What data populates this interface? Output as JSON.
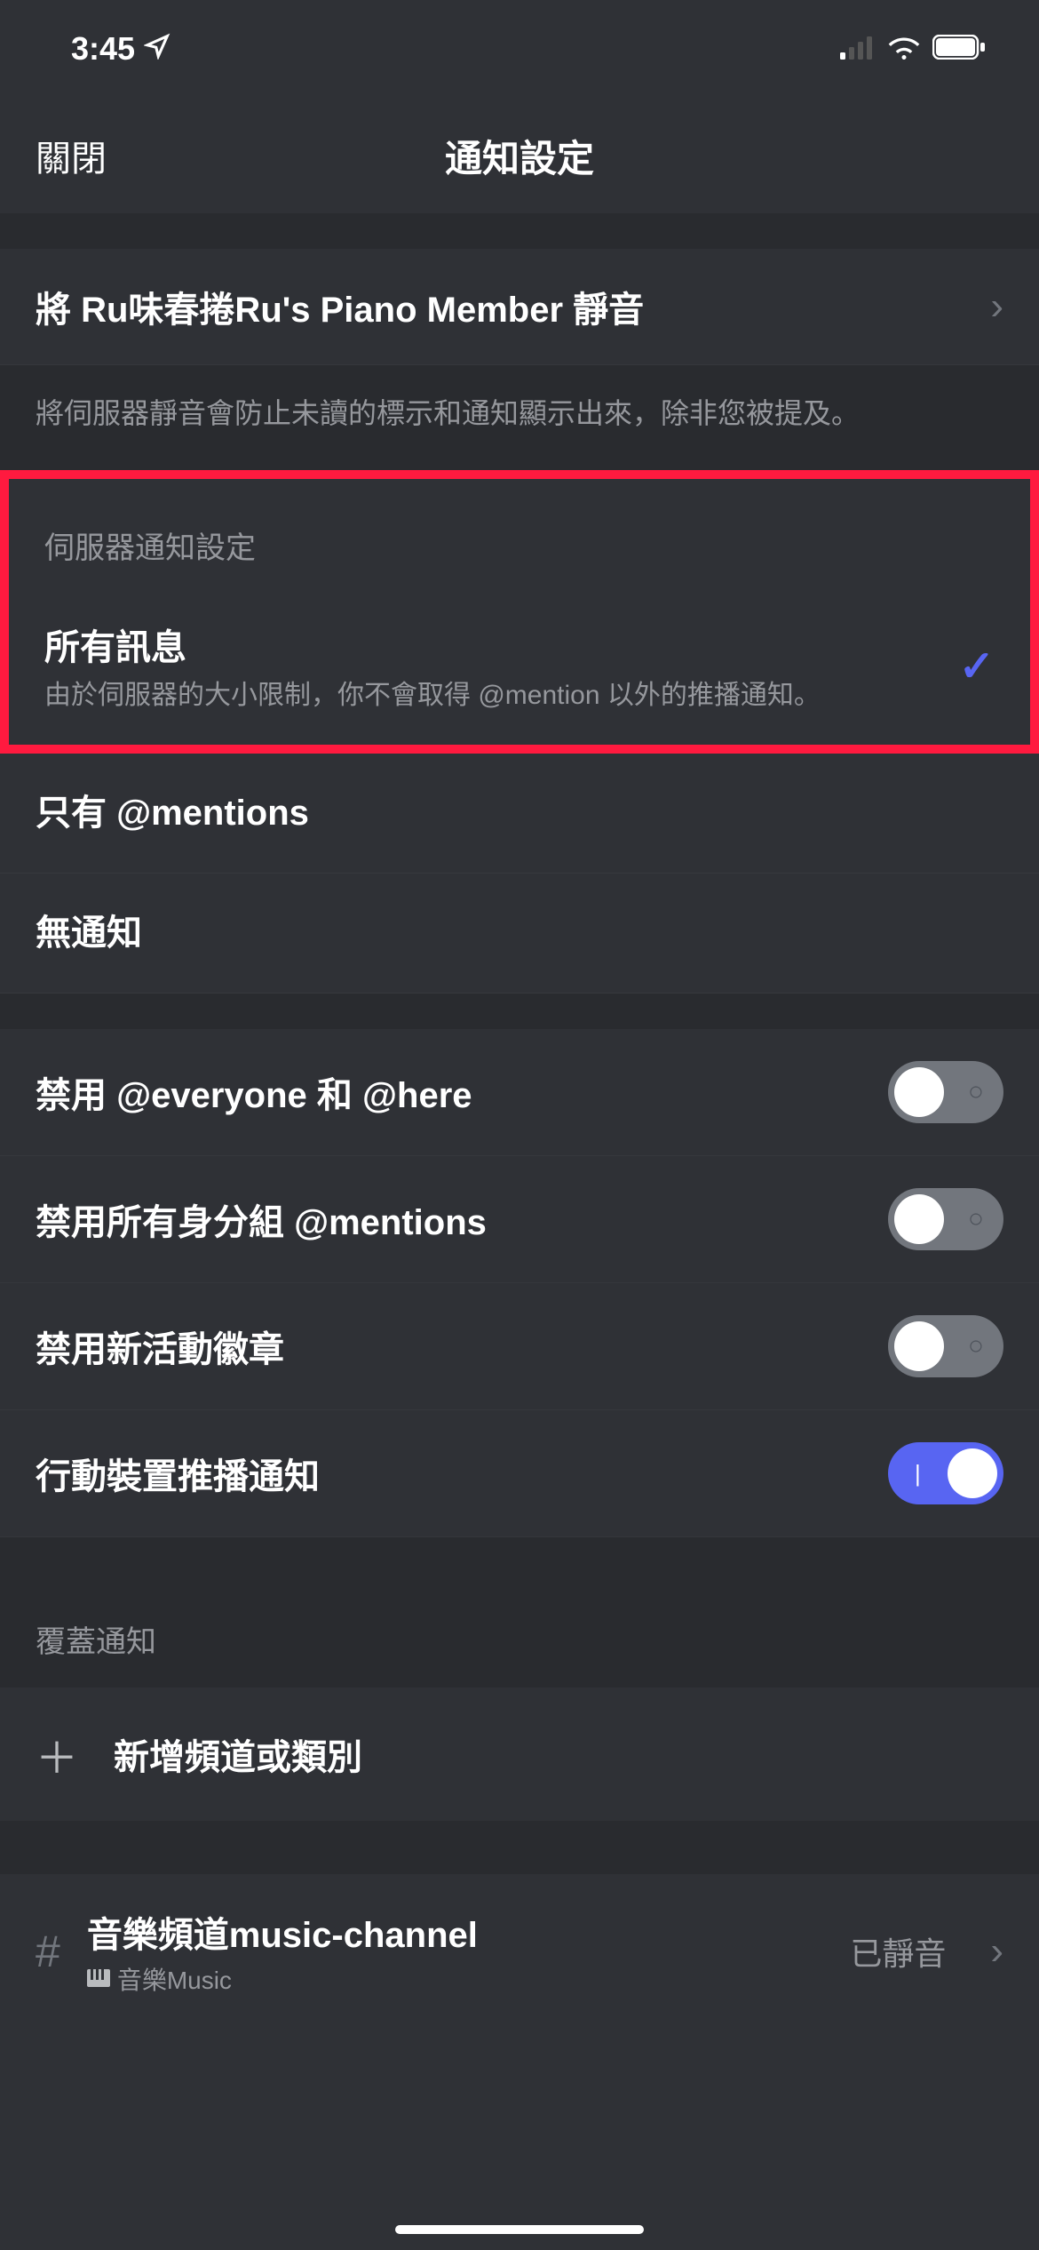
{
  "status": {
    "time": "3:45"
  },
  "nav": {
    "close": "關閉",
    "title": "通知設定"
  },
  "mute": {
    "label": "將 Ru味春捲Ru's Piano Member 靜音",
    "helper": "將伺服器靜音會防止未讀的標示和通知顯示出來，除非您被提及。"
  },
  "server_notif": {
    "header": "伺服器通知設定",
    "options": [
      {
        "title": "所有訊息",
        "sub": "由於伺服器的大小限制，你不會取得 @mention 以外的推播通知。",
        "selected": true
      },
      {
        "title": "只有 @mentions",
        "selected": false
      },
      {
        "title": "無通知",
        "selected": false
      }
    ]
  },
  "toggles": [
    {
      "label": "禁用 @everyone 和 @here",
      "on": false
    },
    {
      "label": "禁用所有身分組 @mentions",
      "on": false
    },
    {
      "label": "禁用新活動徽章",
      "on": false
    },
    {
      "label": "行動裝置推播通知",
      "on": true
    }
  ],
  "override": {
    "header": "覆蓋通知",
    "add": "新增頻道或類別"
  },
  "channel": {
    "name": "音樂頻道music-channel",
    "category": "音樂Music",
    "status": "已靜音"
  }
}
